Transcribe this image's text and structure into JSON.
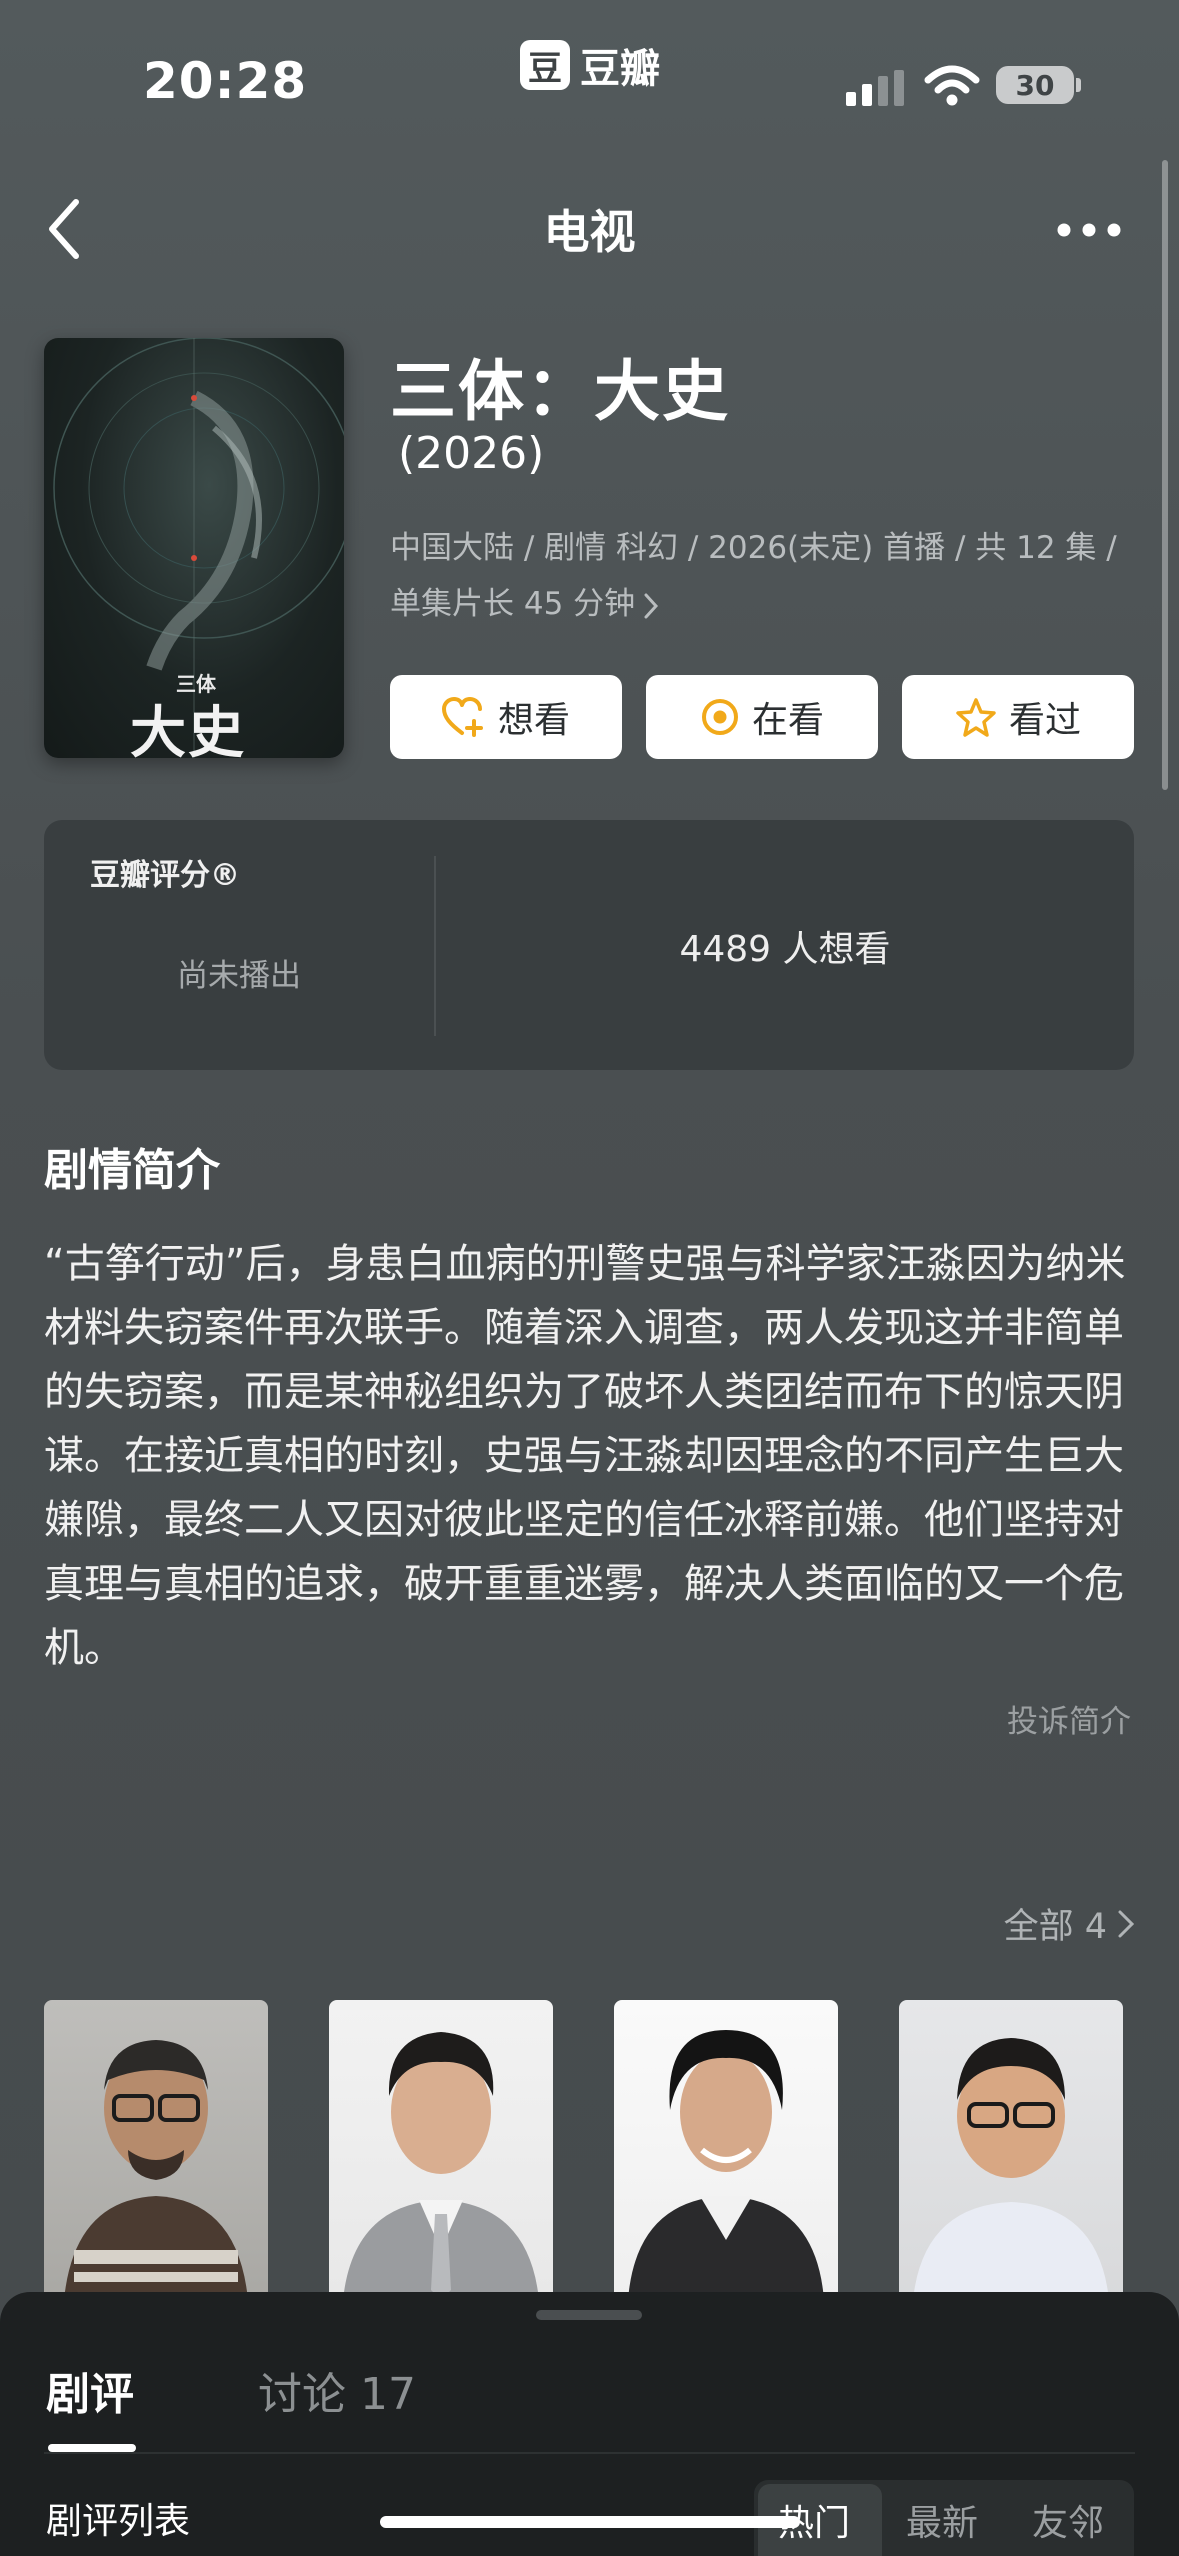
{
  "status_bar": {
    "time": "20:28",
    "app_logo_char": "豆",
    "app_name": "豆瓣",
    "battery": "30"
  },
  "nav": {
    "title": "电视",
    "back_icon": "chevron-left-icon",
    "more_icon": "ellipsis-icon"
  },
  "show": {
    "poster_brand": "三体",
    "poster_title": "大史",
    "title": "三体：大史",
    "year": " (2026)",
    "meta": "中国大陆 / 剧情 科幻 / 2026(未定) 首播 / 共 12 集 / 单集片长 45 分钟"
  },
  "actions": [
    {
      "label": "想看",
      "icon": "heart-plus-icon"
    },
    {
      "label": "在看",
      "icon": "target-icon"
    },
    {
      "label": "看过",
      "icon": "star-icon"
    }
  ],
  "rating": {
    "label": "豆瓣评分®",
    "status": "尚未播出",
    "want_count": "4489 人想看"
  },
  "synopsis": {
    "title": "剧情简介",
    "text": "“古筝行动”后，身患白血病的刑警史强与科学家汪淼因为纳米材料失窃案件再次联手。随着深入调查，两人发现这并非简单的失窃案，而是某神秘组织为了破坏人类团结而布下的惊天阴谋。在接近真相的时刻，史强与汪淼却因理念的不同产生巨大嫌隙，最终二人又因对彼此坚定的信任冰释前嫌。他们坚持对真理与真相的追求，破开重重迷雾，解决人类面临的又一个危机。",
    "report": "投诉简介"
  },
  "cast": {
    "all_label": "全部 4"
  },
  "sheet": {
    "tab_reviews": "剧评",
    "tab_discuss": "讨论 17",
    "list_label": "剧评列表",
    "sort_options": [
      "热门",
      "最新",
      "友邻"
    ],
    "sort_selected": "热门"
  }
}
